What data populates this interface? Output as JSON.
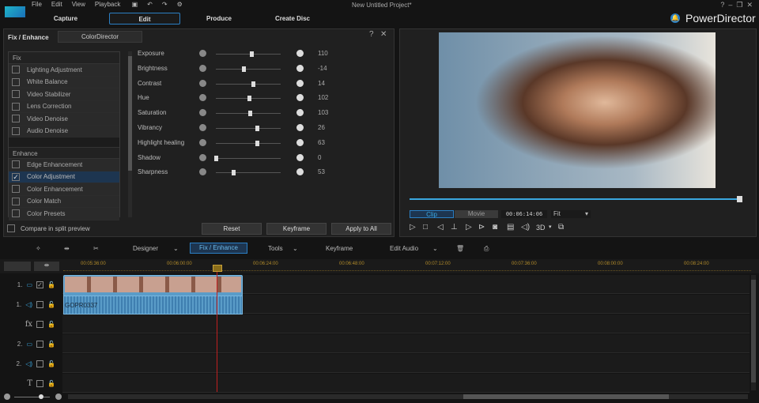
{
  "app": {
    "title": "New Untitled Project*",
    "brand": "PowerDirector",
    "accent": "#2b7fc4"
  },
  "menu": [
    "File",
    "Edit",
    "View",
    "Playback"
  ],
  "tabs": [
    "Capture",
    "Edit",
    "Produce",
    "Create Disc"
  ],
  "fix_panel": {
    "title": "Fix / Enhance",
    "colordirector": "ColorDirector",
    "help": "?",
    "close": "✕",
    "fix_header": "Fix",
    "fix_items": [
      {
        "label": "Lighting Adjustment",
        "checked": false
      },
      {
        "label": "White Balance",
        "checked": false
      },
      {
        "label": "Video Stabilizer",
        "checked": false
      },
      {
        "label": "Lens Correction",
        "checked": false
      },
      {
        "label": "Video Denoise",
        "checked": false
      },
      {
        "label": "Audio Denoise",
        "checked": false
      }
    ],
    "enhance_header": "Enhance",
    "enhance_items": [
      {
        "label": "Edge Enhancement",
        "checked": false
      },
      {
        "label": "Color Adjustment",
        "checked": true
      },
      {
        "label": "Color Enhancement",
        "checked": false
      },
      {
        "label": "Color Match",
        "checked": false
      },
      {
        "label": "Color Presets",
        "checked": false
      }
    ],
    "compare": "Compare in split preview",
    "sliders": [
      {
        "label": "Exposure",
        "value": "110",
        "pos": 0.55
      },
      {
        "label": "Brightness",
        "value": "-14",
        "pos": 0.43
      },
      {
        "label": "Contrast",
        "value": "14",
        "pos": 0.57
      },
      {
        "label": "Hue",
        "value": "102",
        "pos": 0.51
      },
      {
        "label": "Saturation",
        "value": "103",
        "pos": 0.52
      },
      {
        "label": "Vibrancy",
        "value": "26",
        "pos": 0.63
      },
      {
        "label": "Highlight healing",
        "value": "63",
        "pos": 0.63
      },
      {
        "label": "Shadow",
        "value": "0",
        "pos": 0.0
      },
      {
        "label": "Sharpness",
        "value": "53",
        "pos": 0.27
      }
    ],
    "reset": "Reset",
    "keyframe": "Keyframe",
    "apply_all": "Apply to All"
  },
  "preview": {
    "clip": "Clip",
    "movie": "Movie",
    "timecode": "00:06:14:06",
    "fit": "Fit",
    "3d": "3D",
    "progress": 0.99
  },
  "toolbar": {
    "designer": "Designer",
    "fix": "Fix / Enhance",
    "tools": "Tools",
    "keyframe": "Keyframe",
    "edit_audio": "Edit Audio"
  },
  "ruler": [
    "00:05:36:00",
    "00:06:00:00",
    "00:06:24:00",
    "00:06:48:00",
    "00:07:12:00",
    "00:07:36:00",
    "00:08:00:00",
    "00:08:24:00"
  ],
  "tracks": [
    {
      "num": "1.",
      "type": "video"
    },
    {
      "num": "1.",
      "type": "audio"
    },
    {
      "num": "",
      "type": "fx",
      "icon": "fx"
    },
    {
      "num": "2.",
      "type": "video"
    },
    {
      "num": "2.",
      "type": "audio"
    },
    {
      "num": "",
      "type": "title",
      "icon": "T"
    }
  ],
  "clip": {
    "name": "GOPR0337"
  }
}
